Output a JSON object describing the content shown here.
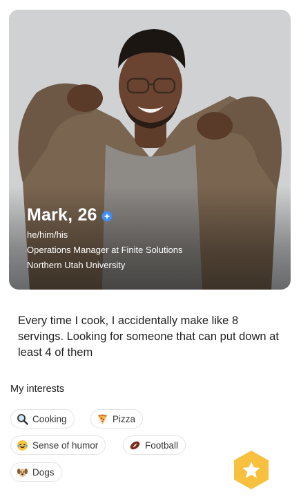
{
  "profile": {
    "name_age": "Mark, 26",
    "pronouns": "he/him/his",
    "job": "Operations Manager at Finite Solutions",
    "school": "Northern Utah University"
  },
  "bio": "Every time I cook, I accidentally make like 8 servings. Looking for someone that can put down at least 4 of them",
  "interests": {
    "heading": "My interests",
    "items": [
      {
        "label": "Cooking",
        "icon": "magnifier-icon"
      },
      {
        "label": "Pizza",
        "icon": "pizza-icon"
      },
      {
        "label": "Sense of humor",
        "icon": "laughing-face-icon"
      },
      {
        "label": "Football",
        "icon": "football-icon"
      },
      {
        "label": "Dogs",
        "icon": "dog-icon"
      }
    ]
  },
  "colors": {
    "verified": "#3d8ff5",
    "fab": "#f7c13f"
  }
}
